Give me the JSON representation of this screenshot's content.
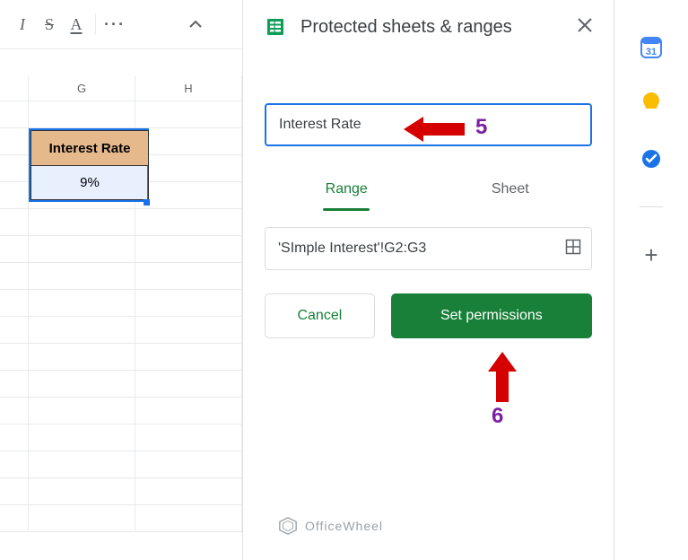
{
  "toolbar": {
    "italic": "I",
    "strike": "S",
    "textcolor": "A",
    "more": "···",
    "collapse": "⌃"
  },
  "columns": [
    "G",
    "H"
  ],
  "cells": {
    "header_label": "Interest Rate",
    "value": "9%"
  },
  "panel": {
    "title": "Protected sheets & ranges",
    "description_value": "Interest Rate",
    "tabs": {
      "range": "Range",
      "sheet": "Sheet"
    },
    "range_value": "'SImple Interest'!G2:G3",
    "cancel": "Cancel",
    "set_permissions": "Set permissions"
  },
  "annotations": {
    "five": "5",
    "six": "6"
  },
  "watermark": "OfficeWheel",
  "companion": {
    "calendar_day": "31"
  }
}
